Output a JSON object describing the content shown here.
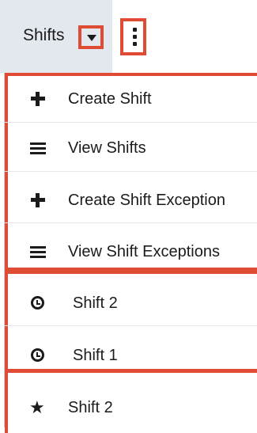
{
  "module": {
    "label": "Shifts"
  },
  "menu": {
    "actions": [
      {
        "label": "Create Shift",
        "icon": "plus-icon"
      },
      {
        "label": "View Shifts",
        "icon": "list-icon"
      },
      {
        "label": "Create Shift Exception",
        "icon": "plus-icon"
      },
      {
        "label": "View Shift Exceptions",
        "icon": "list-icon"
      }
    ],
    "recent": [
      {
        "label": "Shift 2",
        "icon": "clock-icon"
      },
      {
        "label": "Shift 1",
        "icon": "clock-icon"
      }
    ],
    "favorites": [
      {
        "label": "Shift 2",
        "icon": "star-icon"
      }
    ]
  },
  "colors": {
    "highlight": "#e04b35",
    "tab_background": "#e3e8ee"
  }
}
